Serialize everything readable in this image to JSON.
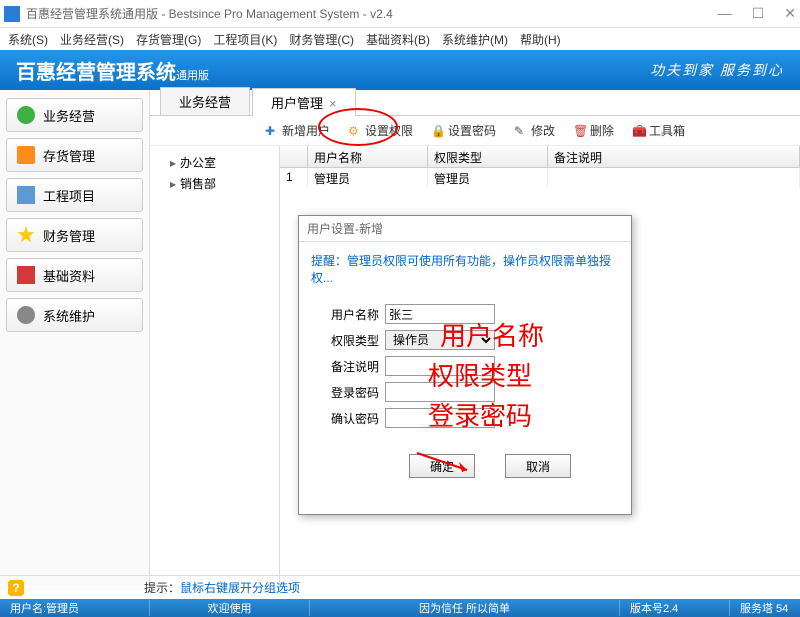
{
  "window": {
    "title": "百惠经营管理系统通用版 - Bestsince Pro Management System - v2.4",
    "minimize": "—",
    "maximize": "☐",
    "close": "✕"
  },
  "menu": [
    "系统(S)",
    "业务经营(S)",
    "存货管理(G)",
    "工程项目(K)",
    "财务管理(C)",
    "基础资料(B)",
    "系统维护(M)",
    "帮助(H)"
  ],
  "banner": {
    "logo_main": "百惠经营管理系统",
    "logo_sub": "通用版",
    "slogan": "功夫到家 服务到心"
  },
  "sidebar": [
    {
      "label": "业务经营",
      "icon": "#3cb043"
    },
    {
      "label": "存货管理",
      "icon": "#ff8c1a"
    },
    {
      "label": "工程项目",
      "icon": "#5a9bd5"
    },
    {
      "label": "财务管理",
      "icon": "#ffcc00"
    },
    {
      "label": "基础资料",
      "icon": "#d23a3a"
    },
    {
      "label": "系统维护",
      "icon": "#888888"
    }
  ],
  "tabs": [
    {
      "label": "业务经营",
      "active": false
    },
    {
      "label": "用户管理",
      "active": true,
      "closable": true
    }
  ],
  "toolbar": [
    {
      "label": "新增用户",
      "icon": "#2b7cd3",
      "glyph": "✚"
    },
    {
      "label": "设置权限",
      "icon": "#ff9933",
      "glyph": "⚙"
    },
    {
      "label": "设置密码",
      "icon": "#ffb400",
      "glyph": "🔒"
    },
    {
      "label": "修改",
      "icon": "#555",
      "glyph": "✎"
    },
    {
      "label": "删除",
      "icon": "#d23a3a",
      "glyph": "🗑"
    },
    {
      "label": "工具箱",
      "icon": "#4a8",
      "glyph": "🧰"
    }
  ],
  "tree": [
    "办公室",
    "销售部"
  ],
  "grid": {
    "headers": {
      "num": "",
      "name": "用户名称",
      "role": "权限类型",
      "note": "备注说明"
    },
    "rows": [
      {
        "num": "1",
        "name": "管理员",
        "role": "管理员",
        "note": ""
      }
    ]
  },
  "dialog": {
    "title": "用户设置-新增",
    "tip": "提醒：管理员权限可使用所有功能，操作员权限需单独授权...",
    "fields": {
      "username_label": "用户名称",
      "username_value": "张三",
      "role_label": "权限类型",
      "role_value": "操作员",
      "note_label": "备注说明",
      "note_value": "",
      "pwd_label": "登录密码",
      "pwd_value": "",
      "pwd2_label": "确认密码",
      "pwd2_value": ""
    },
    "ok": "确定",
    "cancel": "取消"
  },
  "annotations": {
    "a1": "用户名称",
    "a2": "权限类型",
    "a3": "登录密码"
  },
  "hint": {
    "label": "提示：",
    "text": "鼠标右键展开分组选项"
  },
  "status": {
    "user": "用户名:管理员",
    "welcome": "欢迎使用",
    "motto": "因为信任 所以简单",
    "version": "版本号2.4",
    "server": "服务塔 54"
  }
}
